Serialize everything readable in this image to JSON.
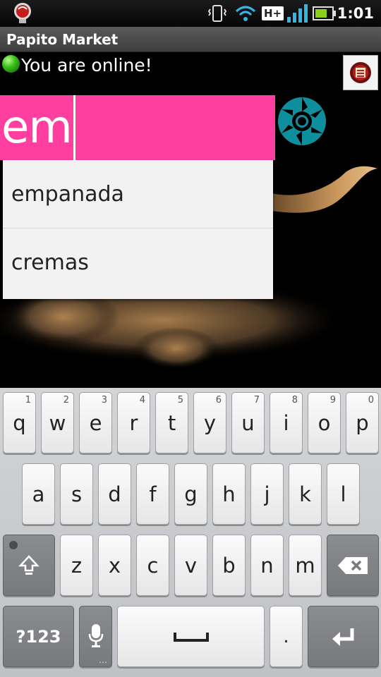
{
  "status_bar": {
    "time": "1:01",
    "network_type": "H+",
    "icons": [
      "app-bulb-icon",
      "vibrate-icon",
      "wifi-icon",
      "network-type-icon",
      "signal-icon",
      "battery-icon"
    ]
  },
  "app": {
    "title": "Papito Market"
  },
  "main": {
    "online_status": "You are online!",
    "online_color": "#3cc21b",
    "search": {
      "value": "em",
      "background": "#ff3fa0"
    },
    "suggestions": [
      "empanada",
      "cremas"
    ],
    "profile_icon": "profile-badge-icon"
  },
  "keyboard": {
    "row1": [
      {
        "ch": "q",
        "num": "1"
      },
      {
        "ch": "w",
        "num": "2"
      },
      {
        "ch": "e",
        "num": "3"
      },
      {
        "ch": "r",
        "num": "4"
      },
      {
        "ch": "t",
        "num": "5"
      },
      {
        "ch": "y",
        "num": "6"
      },
      {
        "ch": "u",
        "num": "7"
      },
      {
        "ch": "i",
        "num": "8"
      },
      {
        "ch": "o",
        "num": "9"
      },
      {
        "ch": "p",
        "num": "0"
      }
    ],
    "row2": [
      "a",
      "s",
      "d",
      "f",
      "g",
      "h",
      "j",
      "k",
      "l"
    ],
    "row3": [
      "z",
      "x",
      "c",
      "v",
      "b",
      "n",
      "m"
    ],
    "symbols_label": "?123",
    "period_label": ".",
    "icons": [
      "shift-icon",
      "backspace-icon",
      "microphone-icon",
      "space-icon",
      "enter-icon"
    ]
  }
}
